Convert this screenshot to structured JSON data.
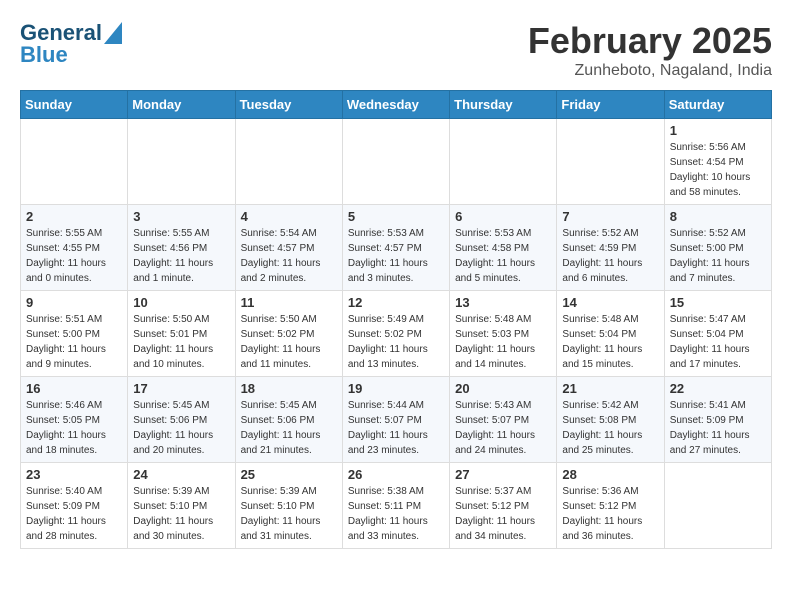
{
  "header": {
    "logo_line1": "General",
    "logo_line2": "Blue",
    "month": "February 2025",
    "location": "Zunheboto, Nagalnd, India"
  },
  "days_of_week": [
    "Sunday",
    "Monday",
    "Tuesday",
    "Wednesday",
    "Thursday",
    "Friday",
    "Saturday"
  ],
  "weeks": [
    [
      {
        "day": "",
        "info": ""
      },
      {
        "day": "",
        "info": ""
      },
      {
        "day": "",
        "info": ""
      },
      {
        "day": "",
        "info": ""
      },
      {
        "day": "",
        "info": ""
      },
      {
        "day": "",
        "info": ""
      },
      {
        "day": "1",
        "info": "Sunrise: 5:56 AM\nSunset: 4:54 PM\nDaylight: 10 hours\nand 58 minutes."
      }
    ],
    [
      {
        "day": "2",
        "info": "Sunrise: 5:55 AM\nSunset: 4:55 PM\nDaylight: 11 hours\nand 0 minutes."
      },
      {
        "day": "3",
        "info": "Sunrise: 5:55 AM\nSunset: 4:56 PM\nDaylight: 11 hours\nand 1 minute."
      },
      {
        "day": "4",
        "info": "Sunrise: 5:54 AM\nSunset: 4:57 PM\nDaylight: 11 hours\nand 2 minutes."
      },
      {
        "day": "5",
        "info": "Sunrise: 5:53 AM\nSunset: 4:57 PM\nDaylight: 11 hours\nand 3 minutes."
      },
      {
        "day": "6",
        "info": "Sunrise: 5:53 AM\nSunset: 4:58 PM\nDaylight: 11 hours\nand 5 minutes."
      },
      {
        "day": "7",
        "info": "Sunrise: 5:52 AM\nSunset: 4:59 PM\nDaylight: 11 hours\nand 6 minutes."
      },
      {
        "day": "8",
        "info": "Sunrise: 5:52 AM\nSunset: 5:00 PM\nDaylight: 11 hours\nand 7 minutes."
      }
    ],
    [
      {
        "day": "9",
        "info": "Sunrise: 5:51 AM\nSunset: 5:00 PM\nDaylight: 11 hours\nand 9 minutes."
      },
      {
        "day": "10",
        "info": "Sunrise: 5:50 AM\nSunset: 5:01 PM\nDaylight: 11 hours\nand 10 minutes."
      },
      {
        "day": "11",
        "info": "Sunrise: 5:50 AM\nSunset: 5:02 PM\nDaylight: 11 hours\nand 11 minutes."
      },
      {
        "day": "12",
        "info": "Sunrise: 5:49 AM\nSunset: 5:02 PM\nDaylight: 11 hours\nand 13 minutes."
      },
      {
        "day": "13",
        "info": "Sunrise: 5:48 AM\nSunset: 5:03 PM\nDaylight: 11 hours\nand 14 minutes."
      },
      {
        "day": "14",
        "info": "Sunrise: 5:48 AM\nSunset: 5:04 PM\nDaylight: 11 hours\nand 15 minutes."
      },
      {
        "day": "15",
        "info": "Sunrise: 5:47 AM\nSunset: 5:04 PM\nDaylight: 11 hours\nand 17 minutes."
      }
    ],
    [
      {
        "day": "16",
        "info": "Sunrise: 5:46 AM\nSunset: 5:05 PM\nDaylight: 11 hours\nand 18 minutes."
      },
      {
        "day": "17",
        "info": "Sunrise: 5:45 AM\nSunset: 5:06 PM\nDaylight: 11 hours\nand 20 minutes."
      },
      {
        "day": "18",
        "info": "Sunrise: 5:45 AM\nSunset: 5:06 PM\nDaylight: 11 hours\nand 21 minutes."
      },
      {
        "day": "19",
        "info": "Sunrise: 5:44 AM\nSunset: 5:07 PM\nDaylight: 11 hours\nand 23 minutes."
      },
      {
        "day": "20",
        "info": "Sunrise: 5:43 AM\nSunset: 5:07 PM\nDaylight: 11 hours\nand 24 minutes."
      },
      {
        "day": "21",
        "info": "Sunrise: 5:42 AM\nSunset: 5:08 PM\nDaylight: 11 hours\nand 25 minutes."
      },
      {
        "day": "22",
        "info": "Sunrise: 5:41 AM\nSunset: 5:09 PM\nDaylight: 11 hours\nand 27 minutes."
      }
    ],
    [
      {
        "day": "23",
        "info": "Sunrise: 5:40 AM\nSunset: 5:09 PM\nDaylight: 11 hours\nand 28 minutes."
      },
      {
        "day": "24",
        "info": "Sunrise: 5:39 AM\nSunset: 5:10 PM\nDaylight: 11 hours\nand 30 minutes."
      },
      {
        "day": "25",
        "info": "Sunrise: 5:39 AM\nSunset: 5:10 PM\nDaylight: 11 hours\nand 31 minutes."
      },
      {
        "day": "26",
        "info": "Sunrise: 5:38 AM\nSunset: 5:11 PM\nDaylight: 11 hours\nand 33 minutes."
      },
      {
        "day": "27",
        "info": "Sunrise: 5:37 AM\nSunset: 5:12 PM\nDaylight: 11 hours\nand 34 minutes."
      },
      {
        "day": "28",
        "info": "Sunrise: 5:36 AM\nSunset: 5:12 PM\nDaylight: 11 hours\nand 36 minutes."
      },
      {
        "day": "",
        "info": ""
      }
    ]
  ]
}
